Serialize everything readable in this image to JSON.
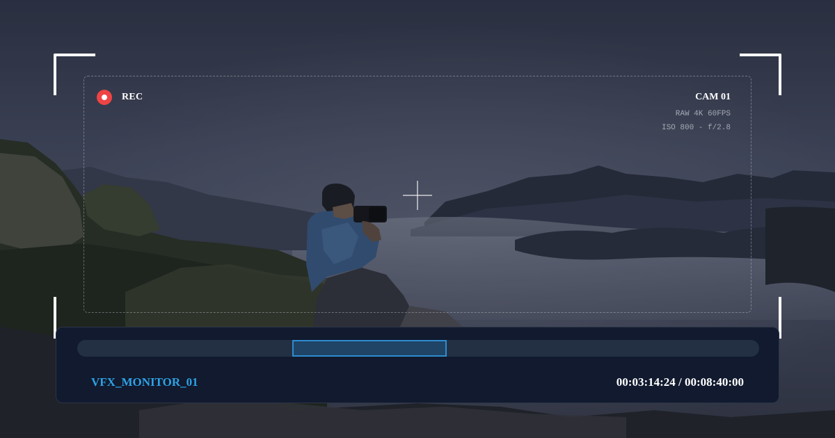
{
  "recording": {
    "label": "REC",
    "indicator_color": "#ef4444"
  },
  "camera": {
    "id": "CAM 01",
    "format": "RAW 4K 60FPS",
    "exposure": "ISO 800 - f/2.8"
  },
  "timeline": {
    "clip_name": "VFX_MONITOR_01",
    "current_time": "00:03:14:24",
    "separator": "/",
    "duration": "00:08:40:00",
    "timecode_display": "00:03:14:24 / 00:08:40:00",
    "selection_start_fraction": 0.315,
    "selection_end_fraction": 0.542,
    "accent_color": "#2ea2e6"
  },
  "icons": {
    "crosshair": "crosshair-icon",
    "record": "record-dot-icon"
  },
  "scene": "viewfinder-background-photo"
}
